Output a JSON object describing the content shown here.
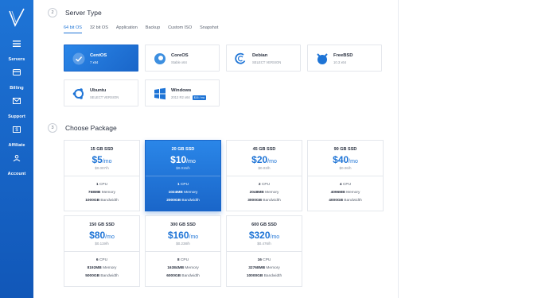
{
  "colors": {
    "accent": "#1e74d6",
    "sidebar": "#1763c9"
  },
  "sidebar": {
    "items": [
      {
        "label": "Servers",
        "icon": "servers-icon"
      },
      {
        "label": "Billing",
        "icon": "billing-icon"
      },
      {
        "label": "Support",
        "icon": "support-icon"
      },
      {
        "label": "Affiliate",
        "icon": "affiliate-icon"
      },
      {
        "label": "Account",
        "icon": "account-icon"
      }
    ]
  },
  "server_type": {
    "step": "2",
    "title": "Server Type",
    "tabs": [
      "64 bit OS",
      "32 bit OS",
      "Application",
      "Backup",
      "Custom ISO",
      "Snapshot"
    ],
    "active_tab": "64 bit OS",
    "os": [
      {
        "name": "CentOS",
        "version": "7  x64",
        "icon": "check-icon"
      },
      {
        "name": "CoreOS",
        "version": "Stable  x64",
        "icon": "coreos-icon"
      },
      {
        "name": "Debian",
        "version": "SELECT VERSION",
        "icon": "debian-icon"
      },
      {
        "name": "FreeBSD",
        "version": "10.3  x64",
        "icon": "freebsd-icon"
      },
      {
        "name": "Ubuntu",
        "version": "SELECT VERSION",
        "icon": "ubuntu-icon"
      },
      {
        "name": "Windows",
        "version": "2012 R2  x64",
        "badge": "$16 / mo",
        "icon": "windows-icon"
      }
    ],
    "selected": "CentOS"
  },
  "package": {
    "step": "3",
    "title": "Choose Package",
    "selected": "20 GB SSD",
    "items": [
      {
        "name": "15 GB SSD",
        "price": "$5",
        "per": "/mo",
        "hourly": "$0.007/h",
        "cpu": "1",
        "memory": "768MB",
        "bandwidth": "1000GB"
      },
      {
        "name": "20 GB SSD",
        "price": "$10",
        "per": "/mo",
        "hourly": "$0.015/h",
        "cpu": "1",
        "memory": "1024MB",
        "bandwidth": "2000GB"
      },
      {
        "name": "45 GB SSD",
        "price": "$20",
        "per": "/mo",
        "hourly": "$0.03/h",
        "cpu": "2",
        "memory": "2048MB",
        "bandwidth": "3000GB"
      },
      {
        "name": "90 GB SSD",
        "price": "$40",
        "per": "/mo",
        "hourly": "$0.06/h",
        "cpu": "4",
        "memory": "4096MB",
        "bandwidth": "4000GB"
      },
      {
        "name": "150 GB SSD",
        "price": "$80",
        "per": "/mo",
        "hourly": "$0.119/h",
        "cpu": "6",
        "memory": "8192MB",
        "bandwidth": "5000GB"
      },
      {
        "name": "300 GB SSD",
        "price": "$160",
        "per": "/mo",
        "hourly": "$0.238/h",
        "cpu": "8",
        "memory": "16384MB",
        "bandwidth": "6000GB"
      },
      {
        "name": "600 GB SSD",
        "price": "$320",
        "per": "/mo",
        "hourly": "$0.476/h",
        "cpu": "16",
        "memory": "32768MB",
        "bandwidth": "10000GB"
      }
    ],
    "labels": {
      "cpu": "CPU",
      "memory": "Memory",
      "bandwidth": "Bandwidth"
    }
  }
}
